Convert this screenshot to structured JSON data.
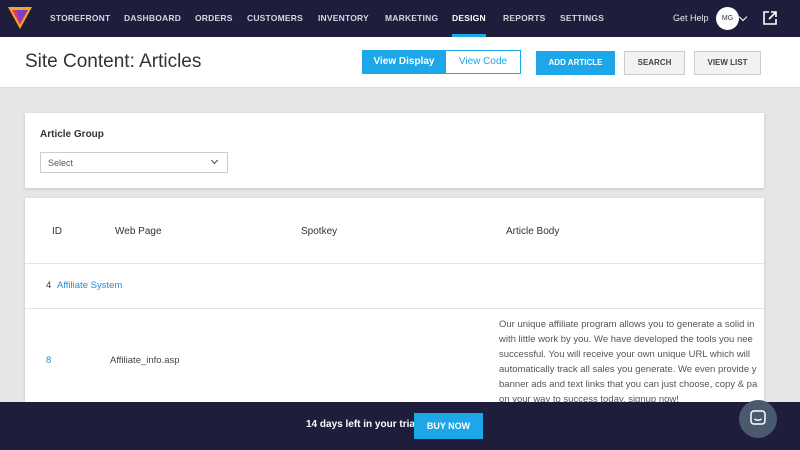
{
  "nav": {
    "items": [
      {
        "label": "STOREFRONT"
      },
      {
        "label": "DASHBOARD"
      },
      {
        "label": "ORDERS"
      },
      {
        "label": "CUSTOMERS"
      },
      {
        "label": "INVENTORY"
      },
      {
        "label": "MARKETING"
      },
      {
        "label": "DESIGN",
        "active": true
      },
      {
        "label": "REPORTS"
      },
      {
        "label": "SETTINGS"
      }
    ],
    "get_help": "Get Help",
    "avatar_initials": "MG"
  },
  "header": {
    "title": "Site Content: Articles",
    "view_display": "View Display",
    "view_code": "View Code",
    "add_article": "ADD ARTICLE",
    "search": "SEARCH",
    "view_list": "VIEW LIST"
  },
  "filter": {
    "label": "Article Group",
    "select_value": "Select"
  },
  "table": {
    "columns": [
      "ID",
      "Web Page",
      "Spotkey",
      "Article Body"
    ],
    "group_row": {
      "id": "4",
      "name": "Affiliate System"
    },
    "rows": [
      {
        "id": "8",
        "web_page": "Affiliate_info.asp",
        "spotkey": "",
        "body_lines": [
          "Our unique affiliate program allows you to generate a solid in",
          "with little work by you. We have developed the tools you nee",
          "successful. You will receive your own unique URL which will",
          "automatically track all sales you generate. We even provide y",
          "banner ads and text links that you can just choose, copy & pa",
          "on your way to success today, signup now!"
        ]
      }
    ]
  },
  "trial": {
    "text": "14 days left in your trial",
    "buy_now": "BUY NOW"
  },
  "colors": {
    "nav_bg": "#1e1e3c",
    "accent": "#1ea7e8",
    "link": "#1e8fd8"
  },
  "icons": [
    "logo-icon",
    "chevron-down-icon",
    "external-link-icon",
    "chat-icon"
  ]
}
